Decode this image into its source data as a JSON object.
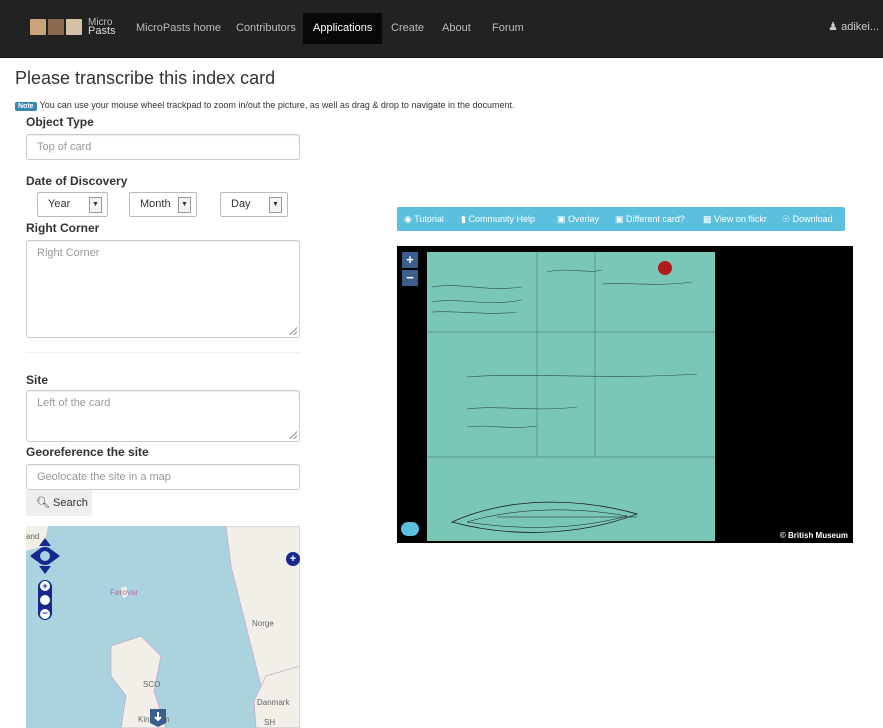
{
  "nav": {
    "brand_top": "Micro",
    "brand_bottom": "Pasts",
    "links": [
      "MicroPasts home",
      "Contributors",
      "Applications",
      "Create",
      "About",
      "Forum"
    ],
    "user": "adikei..."
  },
  "page": {
    "title": "Please transcribe this index card",
    "note_badge": "Note",
    "note_text": "You can use your mouse wheel trackpad to zoom in/out the picture, as well as drag & drop to navigate in the document."
  },
  "form": {
    "object_type_label": "Object Type",
    "object_type_placeholder": "Top of card",
    "date_label": "Date of Discovery",
    "year": "Year",
    "month": "Month",
    "day": "Day",
    "right_corner_label": "Right Corner",
    "right_corner_placeholder": "Right Corner",
    "site_label": "Site",
    "site_placeholder": "Left of the card",
    "georef_label": "Georeference the site",
    "georef_placeholder": "Geolocate the site in a map",
    "search_label": "Search"
  },
  "map": {
    "labels": [
      "and",
      "Føroyar",
      "Norge",
      "SCO",
      "Danmark",
      "Kingdom",
      "SH"
    ]
  },
  "toolbar": {
    "tutorial": "Tutorial",
    "community_help": "Community Help",
    "overlay": "Overlay",
    "different_card": "Different card?",
    "view_flickr": "View on flickr",
    "download": "Download"
  },
  "viewer": {
    "copyright": "© British Museum"
  }
}
